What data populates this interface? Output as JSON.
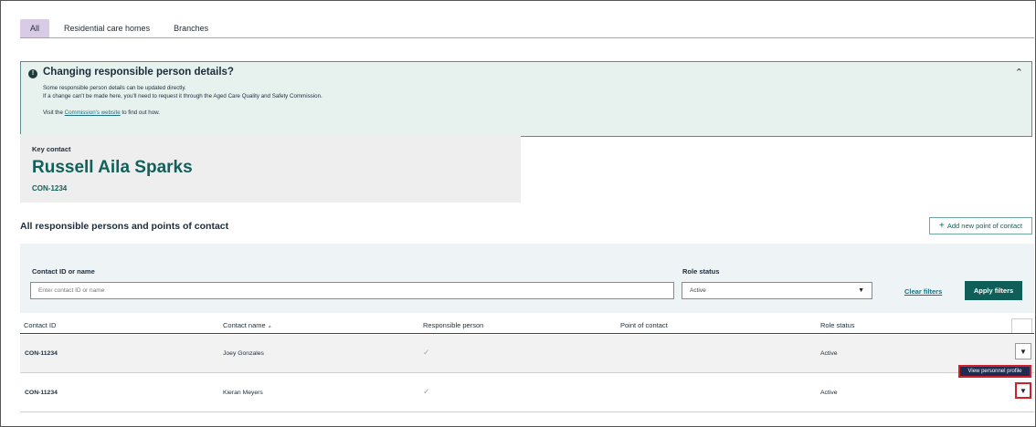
{
  "tabs": [
    {
      "label": "All",
      "active": true
    },
    {
      "label": "Residential care homes",
      "active": false
    },
    {
      "label": "Branches",
      "active": false
    }
  ],
  "alert": {
    "title": "Changing responsible person details?",
    "line1": "Some responsible person details can be updated directly.",
    "line2": "If a change can't be made here, you'll need to request it through the Aged Care Quality and Safety Commission.",
    "line3_prefix": "Visit the ",
    "line3_link": "Commission's website",
    "line3_suffix": " to find out how.",
    "icon": "info-icon",
    "collapse_icon": "chevron-up-icon"
  },
  "key_contact": {
    "label": "Key contact",
    "name": "Russell Aila Sparks",
    "id": "CON-1234"
  },
  "section": {
    "title": "All responsible persons and points of contact",
    "add_button": "Add new point of contact"
  },
  "filters": {
    "contact_label": "Contact ID or name",
    "contact_placeholder": "Enter contact ID or name",
    "status_label": "Role status",
    "status_value": "Active",
    "clear_label": "Clear filters",
    "apply_label": "Apply filters"
  },
  "table": {
    "headers": [
      "Contact ID",
      "Contact name",
      "Responsible person",
      "Point of contact",
      "Role status"
    ],
    "rows": [
      {
        "id": "CON-11234",
        "name": "Joey Gonzales",
        "responsible": "✓",
        "point": "",
        "status": "Active"
      },
      {
        "id": "CON-11234",
        "name": "Kieran Meyers",
        "responsible": "✓",
        "point": "",
        "status": "Active"
      }
    ]
  },
  "tooltip": "View personnel profile",
  "colors": {
    "accent": "#0f5e58",
    "tab_active": "#d9cbe8",
    "alert_bg": "#e7f1ee",
    "highlight": "#d0202b"
  }
}
